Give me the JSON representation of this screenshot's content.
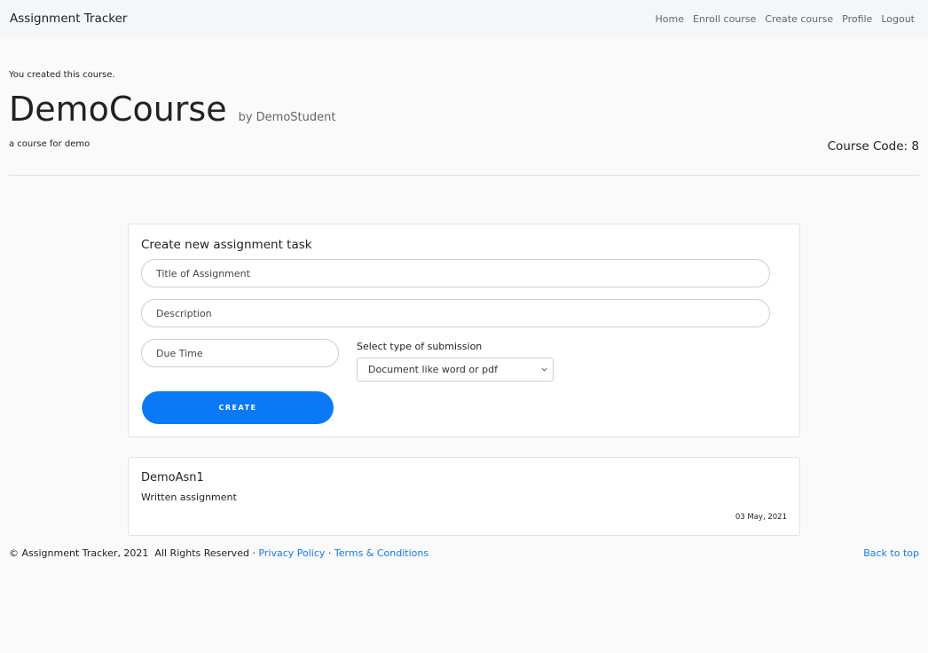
{
  "navbar": {
    "brand": "Assignment Tracker",
    "links": [
      "Home",
      "Enroll course",
      "Create course",
      "Profile",
      "Logout"
    ]
  },
  "course": {
    "created_note": "You created this course.",
    "name": "DemoCourse",
    "by": "by DemoStudent",
    "description": "a course for demo",
    "code": "Course Code: 8"
  },
  "form": {
    "heading": "Create new assignment task",
    "title_placeholder": "Title of Assignment",
    "description_placeholder": "Description",
    "due_placeholder": "Due Time",
    "submission_label": "Select type of submission",
    "submission_selected": "Document like word or pdf",
    "create_label": "CREATE"
  },
  "assignments": [
    {
      "title": "DemoAsn1",
      "description": "Written assignment",
      "date": "03 May, 2021"
    }
  ],
  "footer": {
    "copyright": "© Assignment Tracker, 2021  All Rights Reserved · ",
    "privacy": "Privacy Policy",
    "separator": " · ",
    "terms": "Terms & Conditions",
    "back_to_top": "Back to top"
  },
  "colors": {
    "accent": "#0a79f5",
    "link": "#1b7ae0"
  }
}
